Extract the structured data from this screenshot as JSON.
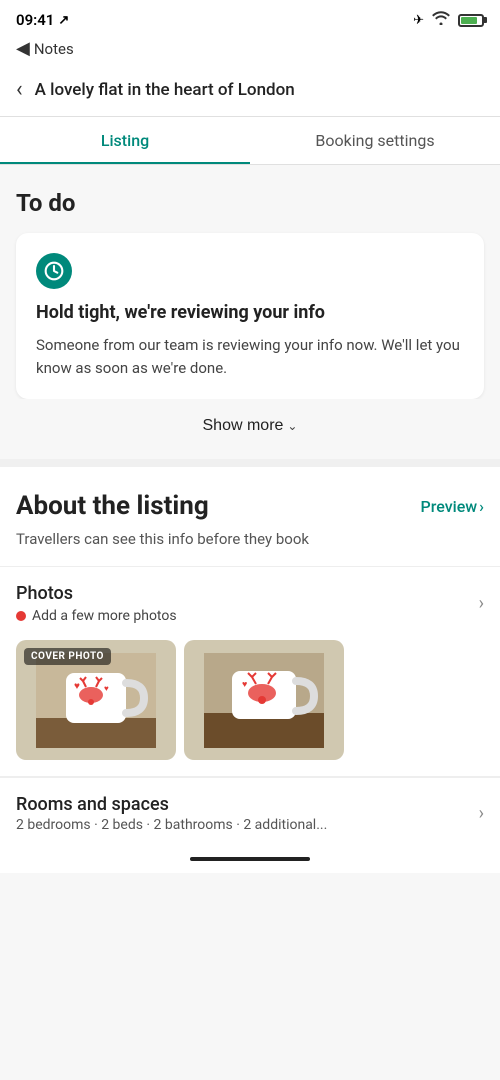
{
  "statusBar": {
    "time": "09:41",
    "locationIcon": "↗",
    "airplaneMode": true,
    "wifi": true,
    "batteryLevel": 80
  },
  "notesBar": {
    "backLabel": "◀ Notes"
  },
  "header": {
    "title": "A lovely flat in the heart of London",
    "backLabel": "‹"
  },
  "tabs": [
    {
      "id": "listing",
      "label": "Listing",
      "active": true
    },
    {
      "id": "booking-settings",
      "label": "Booking settings",
      "active": false
    }
  ],
  "todoSection": {
    "title": "To do",
    "card": {
      "iconAlt": "clock-icon",
      "cardTitle": "Hold tight, we're reviewing your info",
      "cardDesc": "Someone from our team is reviewing your info now. We'll let you know as soon as we're done."
    },
    "showMore": "Show more"
  },
  "aboutSection": {
    "title": "About the listing",
    "previewLabel": "Preview",
    "subtitle": "Travellers can see this info before they book"
  },
  "photosSection": {
    "title": "Photos",
    "alert": "Add a few more photos",
    "coverPhotoLabel": "COVER PHOTO",
    "photos": [
      {
        "id": "photo-1",
        "isCover": true
      },
      {
        "id": "photo-2",
        "isCover": false
      }
    ]
  },
  "roomsSection": {
    "title": "Rooms and spaces",
    "subtitle": "2 bedrooms · 2 beds · 2 bathrooms · 2 additional..."
  }
}
